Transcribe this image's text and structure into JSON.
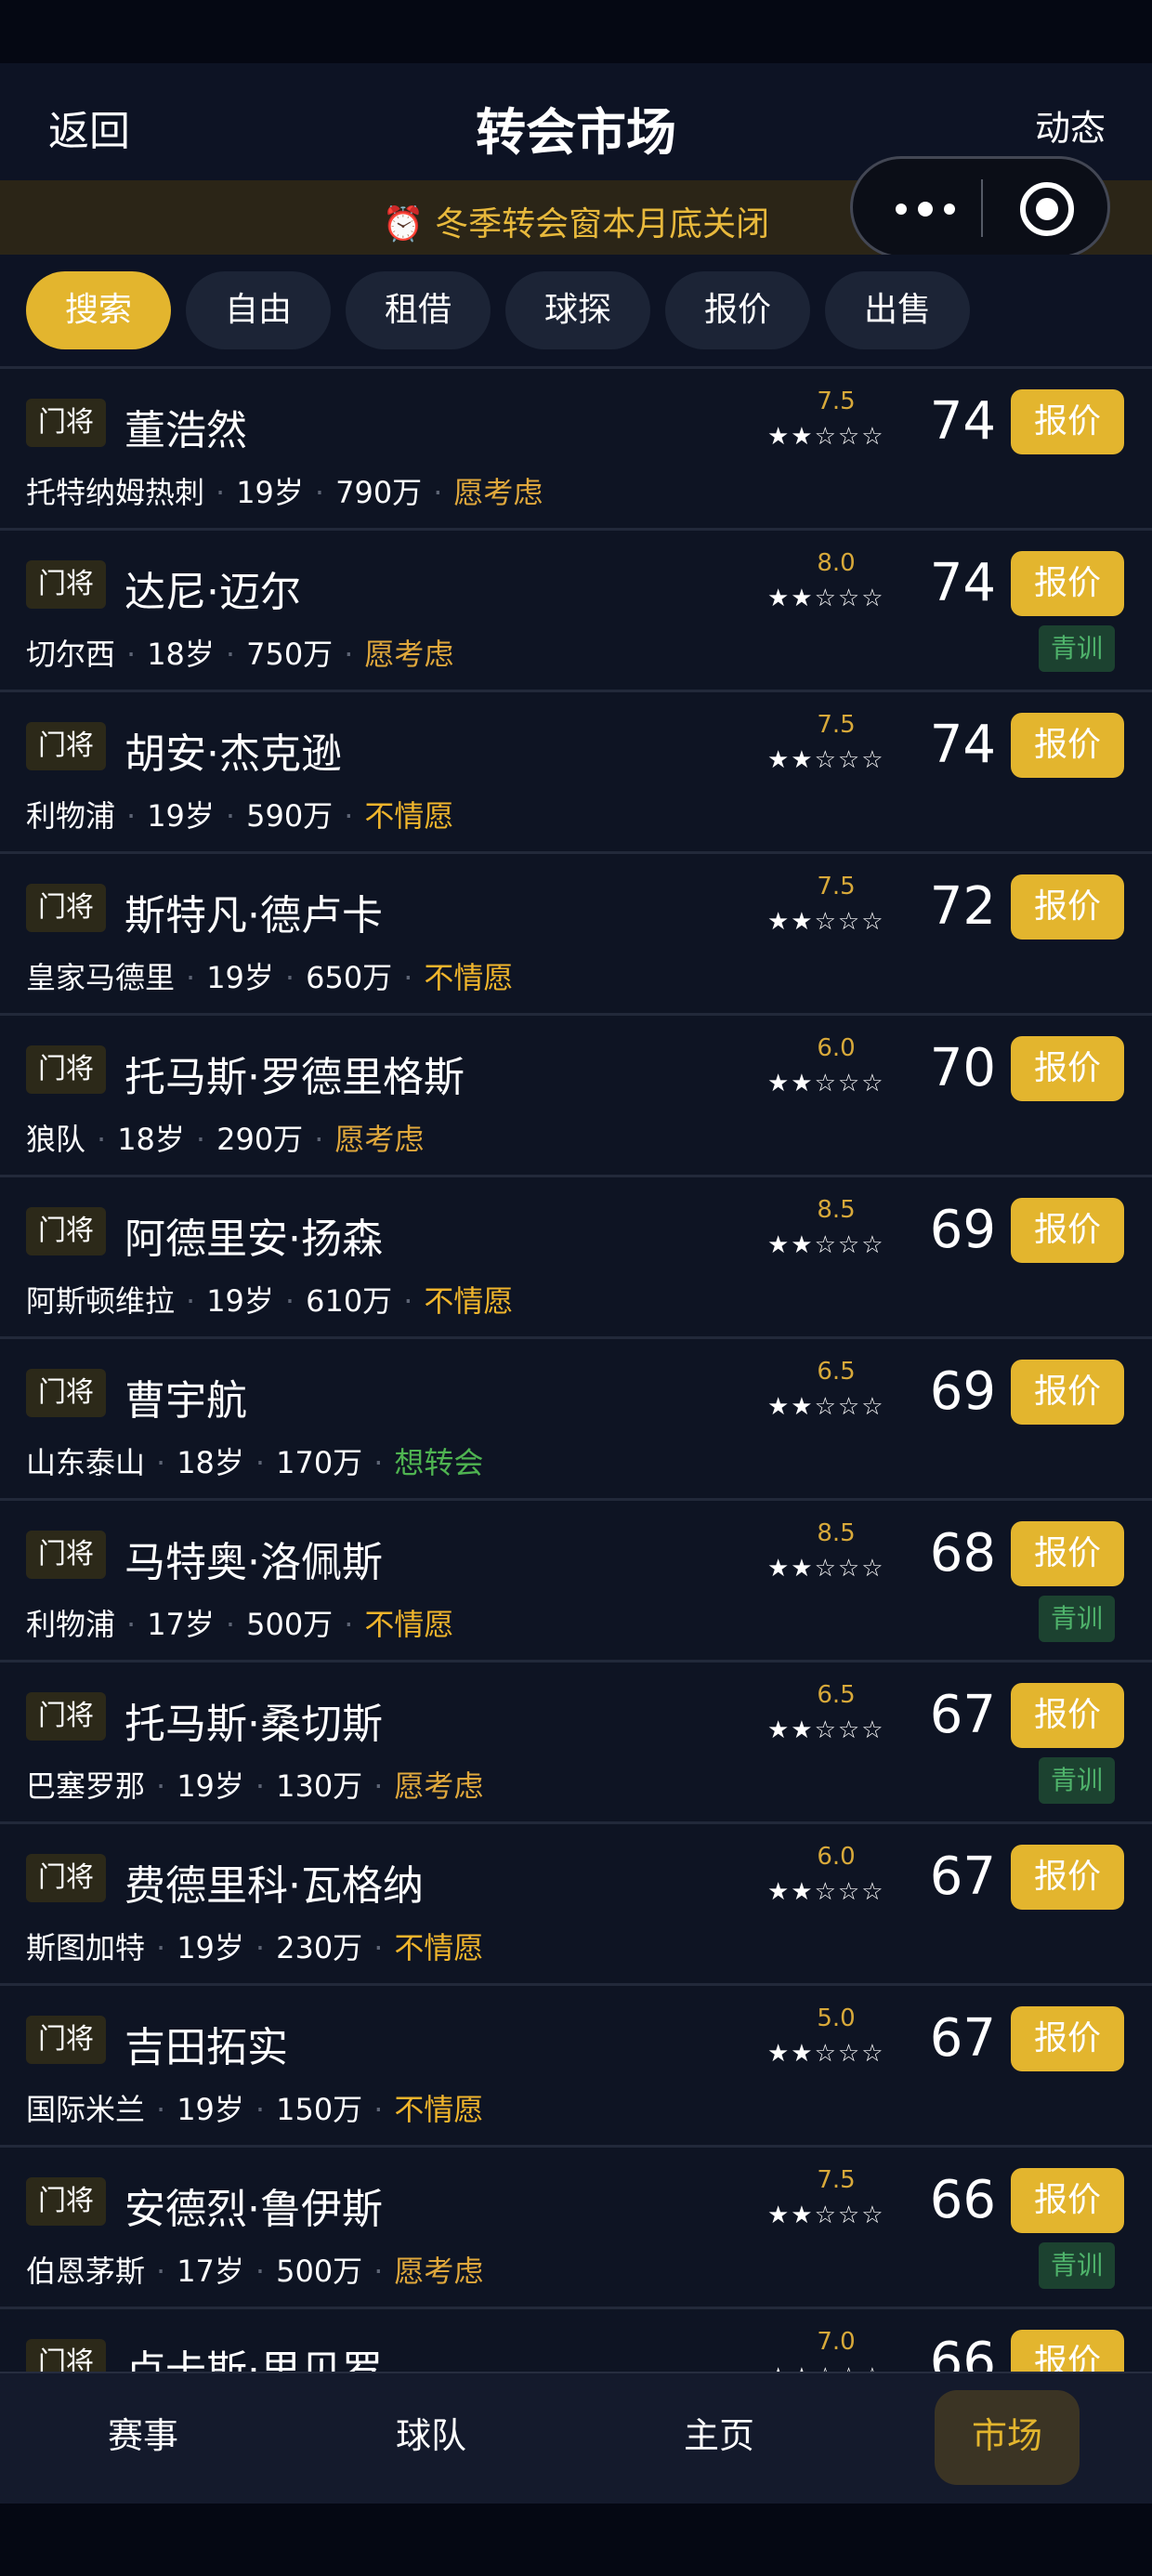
{
  "nav": {
    "back": "返回",
    "title": "转会市场",
    "activity": "动态"
  },
  "notice": "⏰ 冬季转会窗本月底关闭",
  "tabs": [
    "搜索",
    "自由",
    "租借",
    "球探",
    "报价",
    "出售"
  ],
  "active_tab": 0,
  "offer_label": "报价",
  "youth_label": "青训",
  "players": [
    {
      "pos": "门将",
      "name": "董浩然",
      "club": "托特纳姆热刺",
      "age": "19岁",
      "value": "790万",
      "status": "愿考虑",
      "status_type": "considering",
      "potential": "7.5",
      "stars": "★★☆☆☆",
      "rating": "74",
      "youth": false
    },
    {
      "pos": "门将",
      "name": "达尼·迈尔",
      "club": "切尔西",
      "age": "18岁",
      "value": "750万",
      "status": "愿考虑",
      "status_type": "considering",
      "potential": "8.0",
      "stars": "★★☆☆☆",
      "rating": "74",
      "youth": true
    },
    {
      "pos": "门将",
      "name": "胡安·杰克逊",
      "club": "利物浦",
      "age": "19岁",
      "value": "590万",
      "status": "不情愿",
      "status_type": "reluctant",
      "potential": "7.5",
      "stars": "★★☆☆☆",
      "rating": "74",
      "youth": false
    },
    {
      "pos": "门将",
      "name": "斯特凡·德卢卡",
      "club": "皇家马德里",
      "age": "19岁",
      "value": "650万",
      "status": "不情愿",
      "status_type": "reluctant",
      "potential": "7.5",
      "stars": "★★☆☆☆",
      "rating": "72",
      "youth": false
    },
    {
      "pos": "门将",
      "name": "托马斯·罗德里格斯",
      "club": "狼队",
      "age": "18岁",
      "value": "290万",
      "status": "愿考虑",
      "status_type": "considering",
      "potential": "6.0",
      "stars": "★★☆☆☆",
      "rating": "70",
      "youth": false
    },
    {
      "pos": "门将",
      "name": "阿德里安·扬森",
      "club": "阿斯顿维拉",
      "age": "19岁",
      "value": "610万",
      "status": "不情愿",
      "status_type": "reluctant",
      "potential": "8.5",
      "stars": "★★☆☆☆",
      "rating": "69",
      "youth": false
    },
    {
      "pos": "门将",
      "name": "曹宇航",
      "club": "山东泰山",
      "age": "18岁",
      "value": "170万",
      "status": "想转会",
      "status_type": "willing",
      "potential": "6.5",
      "stars": "★★☆☆☆",
      "rating": "69",
      "youth": false
    },
    {
      "pos": "门将",
      "name": "马特奥·洛佩斯",
      "club": "利物浦",
      "age": "17岁",
      "value": "500万",
      "status": "不情愿",
      "status_type": "reluctant",
      "potential": "8.5",
      "stars": "★★☆☆☆",
      "rating": "68",
      "youth": true
    },
    {
      "pos": "门将",
      "name": "托马斯·桑切斯",
      "club": "巴塞罗那",
      "age": "19岁",
      "value": "130万",
      "status": "愿考虑",
      "status_type": "considering",
      "potential": "6.5",
      "stars": "★★☆☆☆",
      "rating": "67",
      "youth": true
    },
    {
      "pos": "门将",
      "name": "费德里科·瓦格纳",
      "club": "斯图加特",
      "age": "19岁",
      "value": "230万",
      "status": "不情愿",
      "status_type": "reluctant",
      "potential": "6.0",
      "stars": "★★☆☆☆",
      "rating": "67",
      "youth": false
    },
    {
      "pos": "门将",
      "name": "吉田拓实",
      "club": "国际米兰",
      "age": "19岁",
      "value": "150万",
      "status": "不情愿",
      "status_type": "reluctant",
      "potential": "5.0",
      "stars": "★★☆☆☆",
      "rating": "67",
      "youth": false
    },
    {
      "pos": "门将",
      "name": "安德烈·鲁伊斯",
      "club": "伯恩茅斯",
      "age": "17岁",
      "value": "500万",
      "status": "愿考虑",
      "status_type": "considering",
      "potential": "7.5",
      "stars": "★★☆☆☆",
      "rating": "66",
      "youth": true
    },
    {
      "pos": "门将",
      "name": "卢卡斯·里贝罗",
      "club": "",
      "age": "",
      "value": "",
      "status": "",
      "status_type": "considering",
      "potential": "7.0",
      "stars": "★★☆☆☆",
      "rating": "66",
      "youth": false
    }
  ],
  "bottom_nav": [
    "赛事",
    "球队",
    "主页",
    "市场"
  ],
  "bottom_nav_active": 3,
  "colors": {
    "accent": "#e3b52e",
    "background": "#0e1423",
    "willing": "#4fb451",
    "considering": "#e0a83c"
  },
  "icons": {
    "capsule_more": "more-dots-icon",
    "capsule_close": "target-circle-icon"
  }
}
